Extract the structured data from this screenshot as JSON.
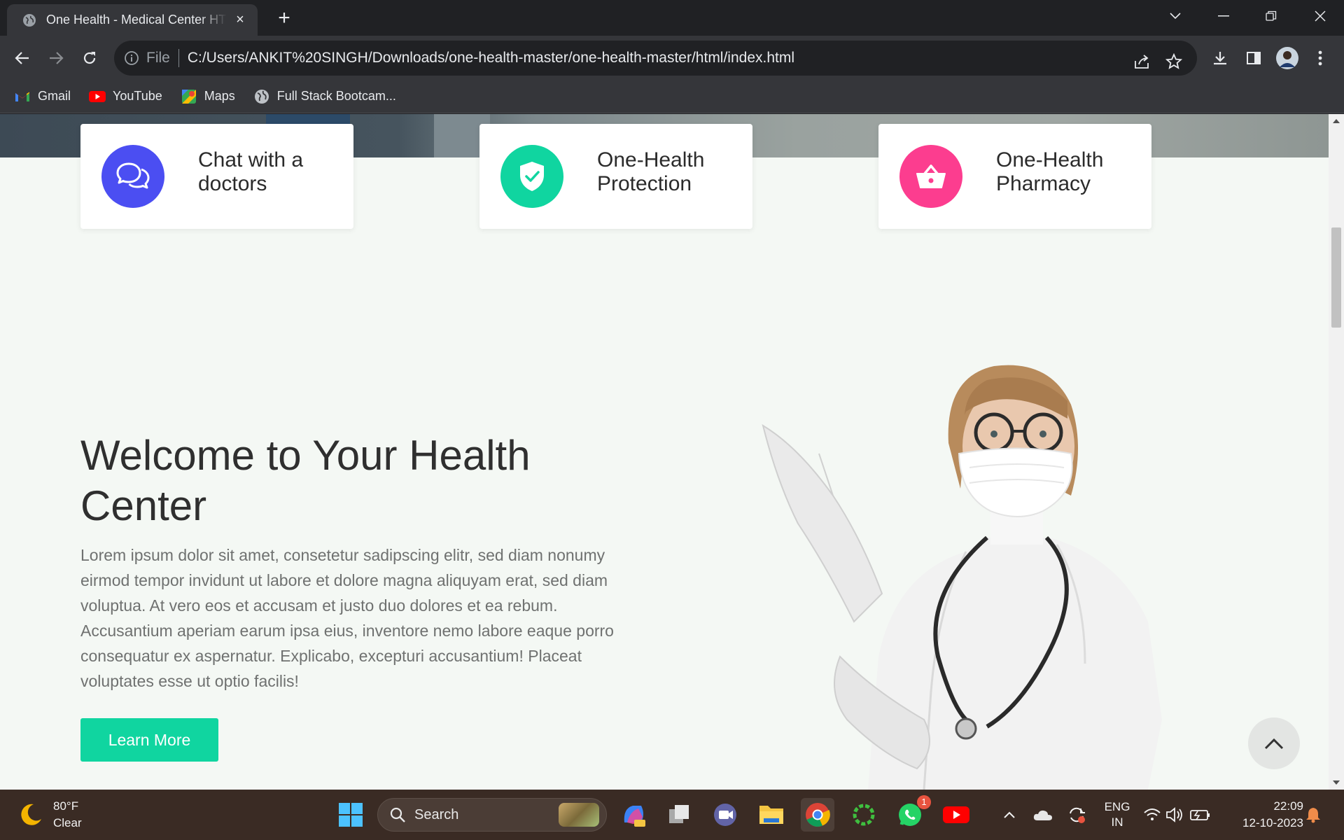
{
  "browser": {
    "tab_title": "One Health - Medical Center HTML",
    "tab_close": "×",
    "new_tab": "+",
    "url_scheme": "File",
    "url": "C:/Users/ANKIT%20SINGH/Downloads/one-health-master/one-health-master/html/index.html",
    "bookmarks": [
      {
        "label": "Gmail",
        "icon": "gmail-icon"
      },
      {
        "label": "YouTube",
        "icon": "youtube-icon"
      },
      {
        "label": "Maps",
        "icon": "maps-icon"
      },
      {
        "label": "Full Stack Bootcam...",
        "icon": "globe-icon"
      }
    ]
  },
  "features": [
    {
      "label": "Chat with a doctors",
      "icon": "chat-icon",
      "color": "#4b4ef2"
    },
    {
      "label": "One-Health Protection",
      "icon": "shield-icon",
      "color": "#10d5a0"
    },
    {
      "label": "One-Health Pharmacy",
      "icon": "basket-icon",
      "color": "#fc3d8f"
    }
  ],
  "welcome": {
    "title": "Welcome to Your Health Center",
    "body": "Lorem ipsum dolor sit amet, consetetur sadipscing elitr, sed diam nonumy eirmod tempor invidunt ut labore et dolore magna aliquyam erat, sed diam voluptua. At vero eos et accusam et justo duo dolores et ea rebum. Accusantium aperiam earum ipsa eius, inventore nemo labore eaque porro consequatur ex aspernatur. Explicabo, excepturi accusantium! Placeat voluptates esse ut optio facilis!",
    "button": "Learn More"
  },
  "taskbar": {
    "weather_temp": "80°F",
    "weather_desc": "Clear",
    "search_placeholder": "Search",
    "whatsapp_badge": "1",
    "lang_line1": "ENG",
    "lang_line2": "IN",
    "time": "22:09",
    "date": "12-10-2023"
  },
  "colors": {
    "accent": "#10d5a0",
    "chat": "#4b4ef2",
    "pharmacy": "#fc3d8f"
  }
}
